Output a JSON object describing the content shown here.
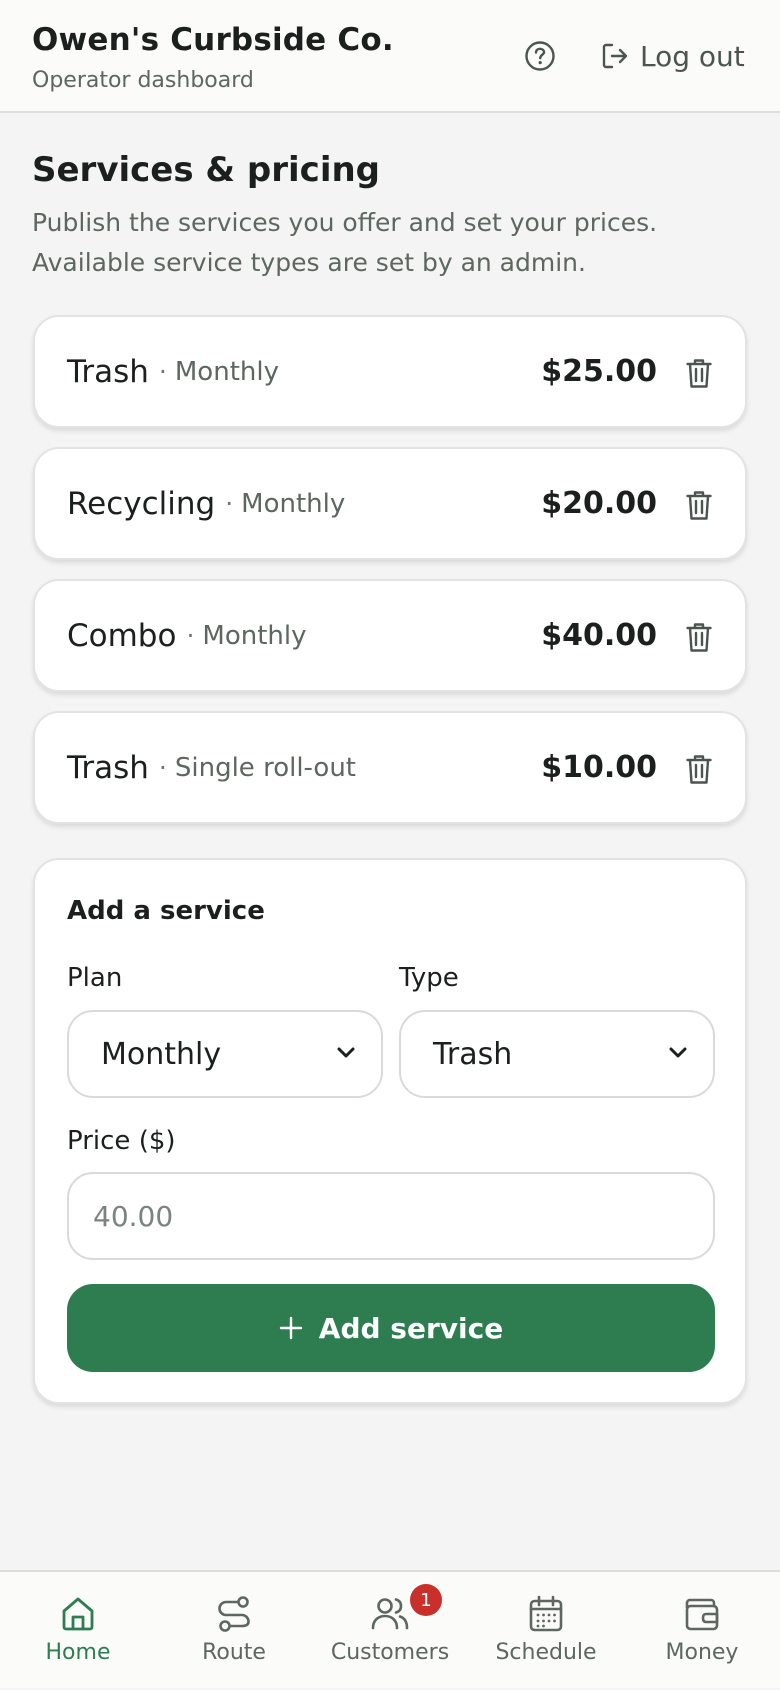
{
  "header": {
    "business_name": "Owen's Curbside Co.",
    "subtitle": "Operator dashboard",
    "help_icon": "question-circle-icon",
    "logout_label": "Log out"
  },
  "section": {
    "title": "Services & pricing",
    "description": "Publish the services you offer and set your prices. Available service types are set by an admin."
  },
  "services": [
    {
      "name": "Trash",
      "separator": "·",
      "plan": "Monthly",
      "price": "$25.00"
    },
    {
      "name": "Recycling",
      "separator": "·",
      "plan": "Monthly",
      "price": "$20.00"
    },
    {
      "name": "Combo",
      "separator": "·",
      "plan": "Monthly",
      "price": "$40.00"
    },
    {
      "name": "Trash",
      "separator": "·",
      "plan": "Single roll-out",
      "price": "$10.00"
    }
  ],
  "add_form": {
    "title": "Add a service",
    "plan_label": "Plan",
    "plan_value": "Monthly",
    "type_label": "Type",
    "type_value": "Trash",
    "price_label": "Price ($)",
    "price_placeholder": "40.00",
    "submit_label": "Add service"
  },
  "nav": {
    "items": [
      {
        "label": "Home",
        "icon": "home-icon",
        "active": true
      },
      {
        "label": "Route",
        "icon": "route-icon"
      },
      {
        "label": "Customers",
        "icon": "users-icon",
        "badge": "1"
      },
      {
        "label": "Schedule",
        "icon": "calendar-icon"
      },
      {
        "label": "Money",
        "icon": "wallet-icon"
      }
    ]
  },
  "colors": {
    "accent": "#2e7d51",
    "badge": "#c9302c",
    "background": "#f3f4f3"
  }
}
